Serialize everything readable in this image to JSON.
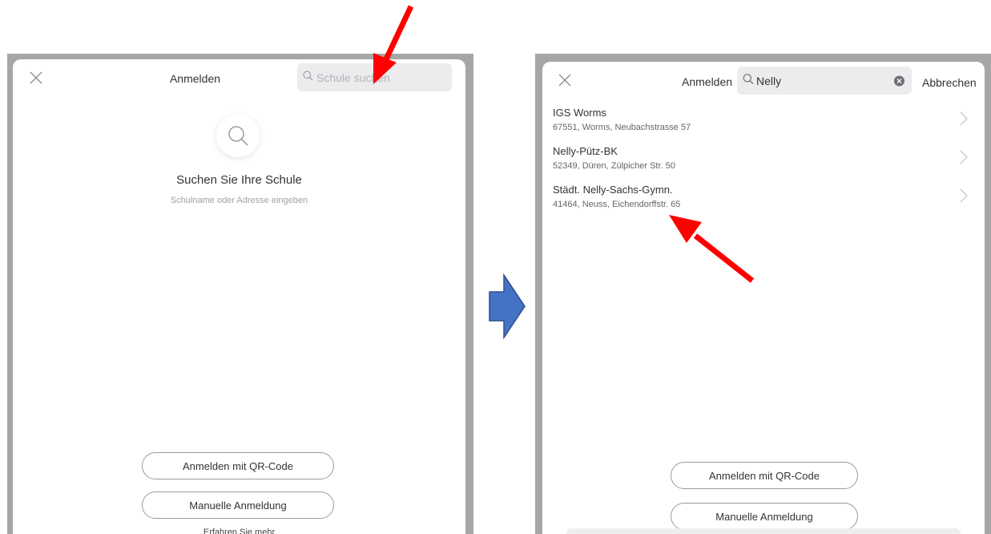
{
  "left_screen": {
    "title": "Anmelden",
    "search_placeholder": "Schule suchen",
    "empty_heading": "Suchen Sie Ihre Schule",
    "empty_subtitle": "Schulname oder Adresse eingeben",
    "qr_button": "Anmelden mit QR-Code",
    "manual_button": "Manuelle Anmeldung",
    "learn_more": "Erfahren Sie mehr"
  },
  "right_screen": {
    "title": "Anmelden",
    "search_value": "Nelly",
    "cancel_label": "Abbrechen",
    "results": [
      {
        "name": "IGS Worms",
        "address": "67551, Worms, Neubachstrasse 57"
      },
      {
        "name": "Nelly-Pütz-BK",
        "address": "52349, Düren, Zülpicher Str. 50"
      },
      {
        "name": "Städt. Nelly-Sachs-Gymn.",
        "address": "41464, Neuss, Eichendorffstr. 65"
      }
    ],
    "qr_button": "Anmelden mit QR-Code",
    "manual_button": "Manuelle Anmeldung"
  },
  "colors": {
    "annotation_arrow": "#ff0000",
    "transition_arrow_fill": "#4472c4",
    "transition_arrow_stroke": "#2f4f8f",
    "frame": "#a6a6a6"
  },
  "icons": [
    "close-icon",
    "search-icon",
    "clear-icon",
    "chevron-right-icon"
  ]
}
